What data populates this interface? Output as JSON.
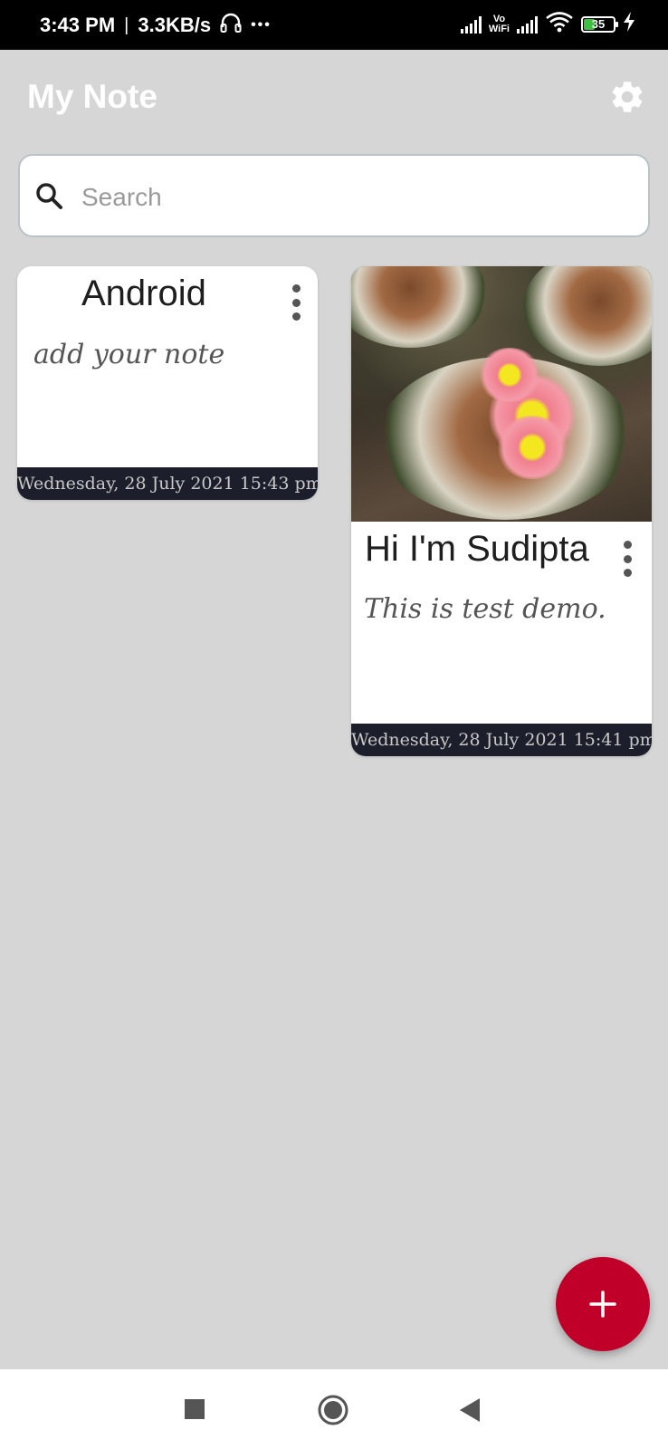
{
  "status_bar": {
    "time": "3:43 PM",
    "separator": "|",
    "net_speed": "3.3KB/s",
    "more": "•••",
    "vowifi_top": "Vo",
    "vowifi_bottom": "WiFi",
    "battery_level": "35",
    "icons": [
      "headphones-icon",
      "signal-icon",
      "vowifi-icon",
      "wifi-icon",
      "battery-icon",
      "charging-icon"
    ]
  },
  "header": {
    "title": "My Note",
    "settings_icon": "gear-icon"
  },
  "search": {
    "placeholder": "Search",
    "value": "",
    "icon": "search-icon"
  },
  "notes": [
    {
      "title": "Android",
      "body": "add your note",
      "timestamp": "Wednesday, 28 July 2021 15:43 pm",
      "has_image": false
    },
    {
      "title": "Hi I'm Sudipta",
      "body": "This is test demo.",
      "timestamp": "Wednesday, 28 July 2021 15:41 pm",
      "has_image": true,
      "image": "cactus-flower-photo"
    }
  ],
  "fab": {
    "icon": "plus-icon",
    "color": "#c1002a"
  },
  "nav_bar": {
    "icons": [
      "recents-square-icon",
      "home-circle-icon",
      "back-triangle-icon"
    ]
  },
  "colors": {
    "background": "#d6d6d6",
    "footer": "#1c1f2b",
    "accent": "#c1002a"
  }
}
